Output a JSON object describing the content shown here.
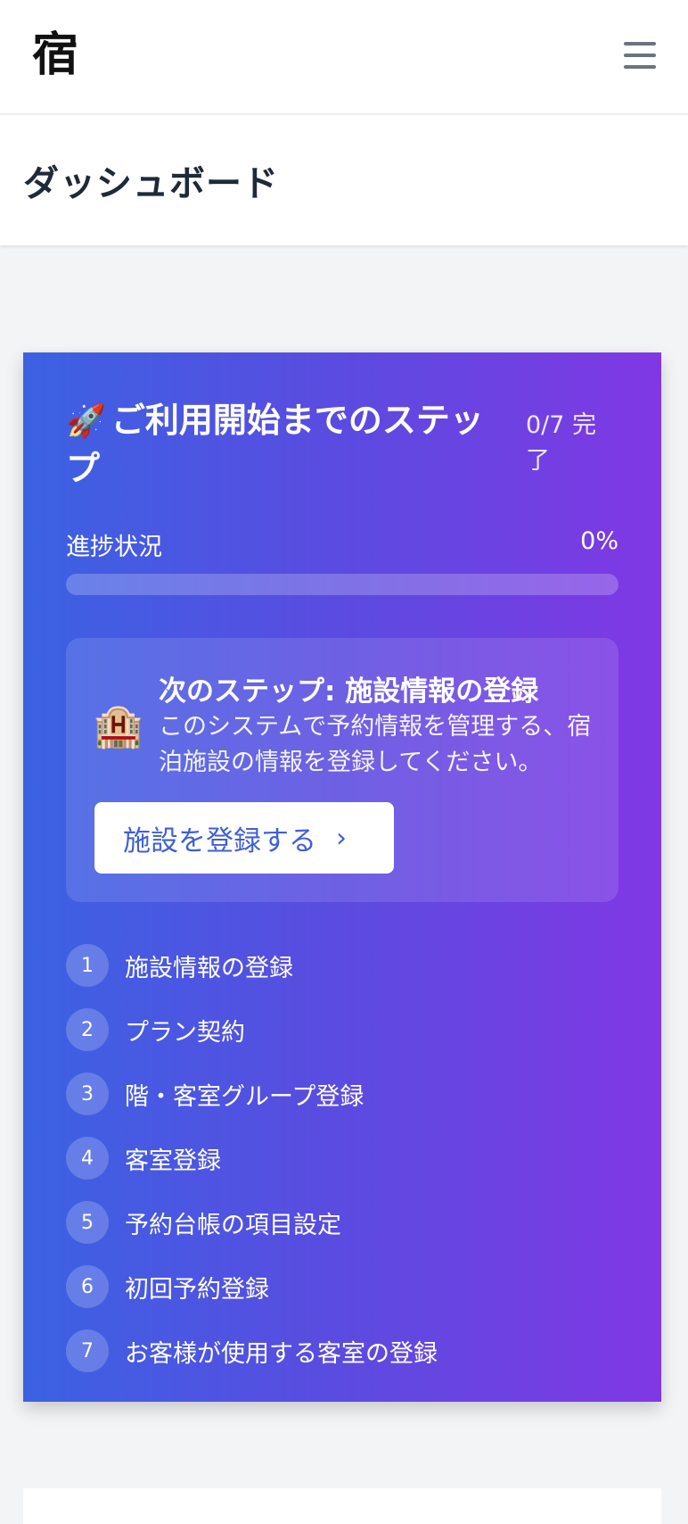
{
  "header": {
    "logo_text": "宿",
    "menu_icon": "hamburger-menu-icon"
  },
  "page": {
    "title": "ダッシュボード"
  },
  "onboarding": {
    "title_icon": "🚀",
    "title": "ご利用開始までのステップ",
    "count": "0/7 完了",
    "progress_label": "進捗状況",
    "progress_percent": "0%",
    "progress_value": 0,
    "next_step": {
      "icon": "🏨",
      "title": "次のステップ: 施設情報の登録",
      "description": "このシステムで予約情報を管理する、宿泊施設の情報を登録してください。",
      "button_label": "施設を登録する",
      "button_icon": "›"
    },
    "steps": [
      {
        "num": "1",
        "label": "施設情報の登録"
      },
      {
        "num": "2",
        "label": "プラン契約"
      },
      {
        "num": "3",
        "label": "階・客室グループ登録"
      },
      {
        "num": "4",
        "label": "客室登録"
      },
      {
        "num": "5",
        "label": "予約台帳の項目設定"
      },
      {
        "num": "6",
        "label": "初回予約登録"
      },
      {
        "num": "7",
        "label": "お客様が使用する客室の登録"
      }
    ]
  },
  "colors": {
    "gradient_start": "#3b62e3",
    "gradient_end": "#8038e4",
    "button_text": "#3f5fd6"
  }
}
